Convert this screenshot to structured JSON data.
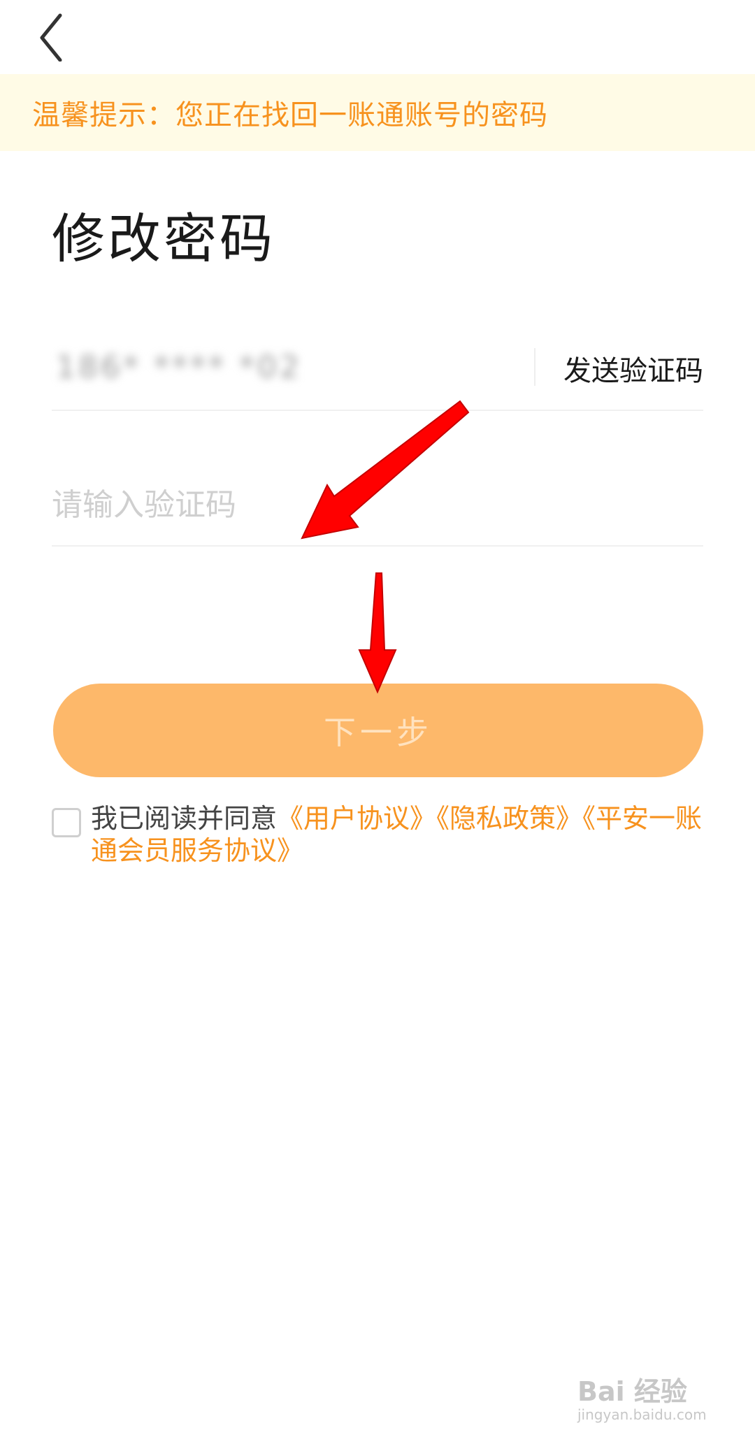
{
  "header": {
    "back_icon": "chevron-left-icon"
  },
  "notice": {
    "text": "温馨提示：您正在找回一账通账号的密码"
  },
  "page": {
    "title": "修改密码"
  },
  "form": {
    "phone_value": "186* **** *02",
    "send_code_label": "发送验证码",
    "code_placeholder": "请输入验证码",
    "next_label": "下一步"
  },
  "agreement": {
    "checked": false,
    "prefix": "我已阅读并同意",
    "links": [
      "《用户协议》",
      "《隐私政策》",
      "《平安一账通会员服务协议》"
    ]
  },
  "watermark": {
    "main": "Bai 经验",
    "sub": "jingyan.baidu.com"
  },
  "colors": {
    "accent": "#f7921e",
    "notice_bg": "#fffbe6",
    "button_bg": "#fdb86a",
    "annotation_arrow": "#ff0000"
  }
}
